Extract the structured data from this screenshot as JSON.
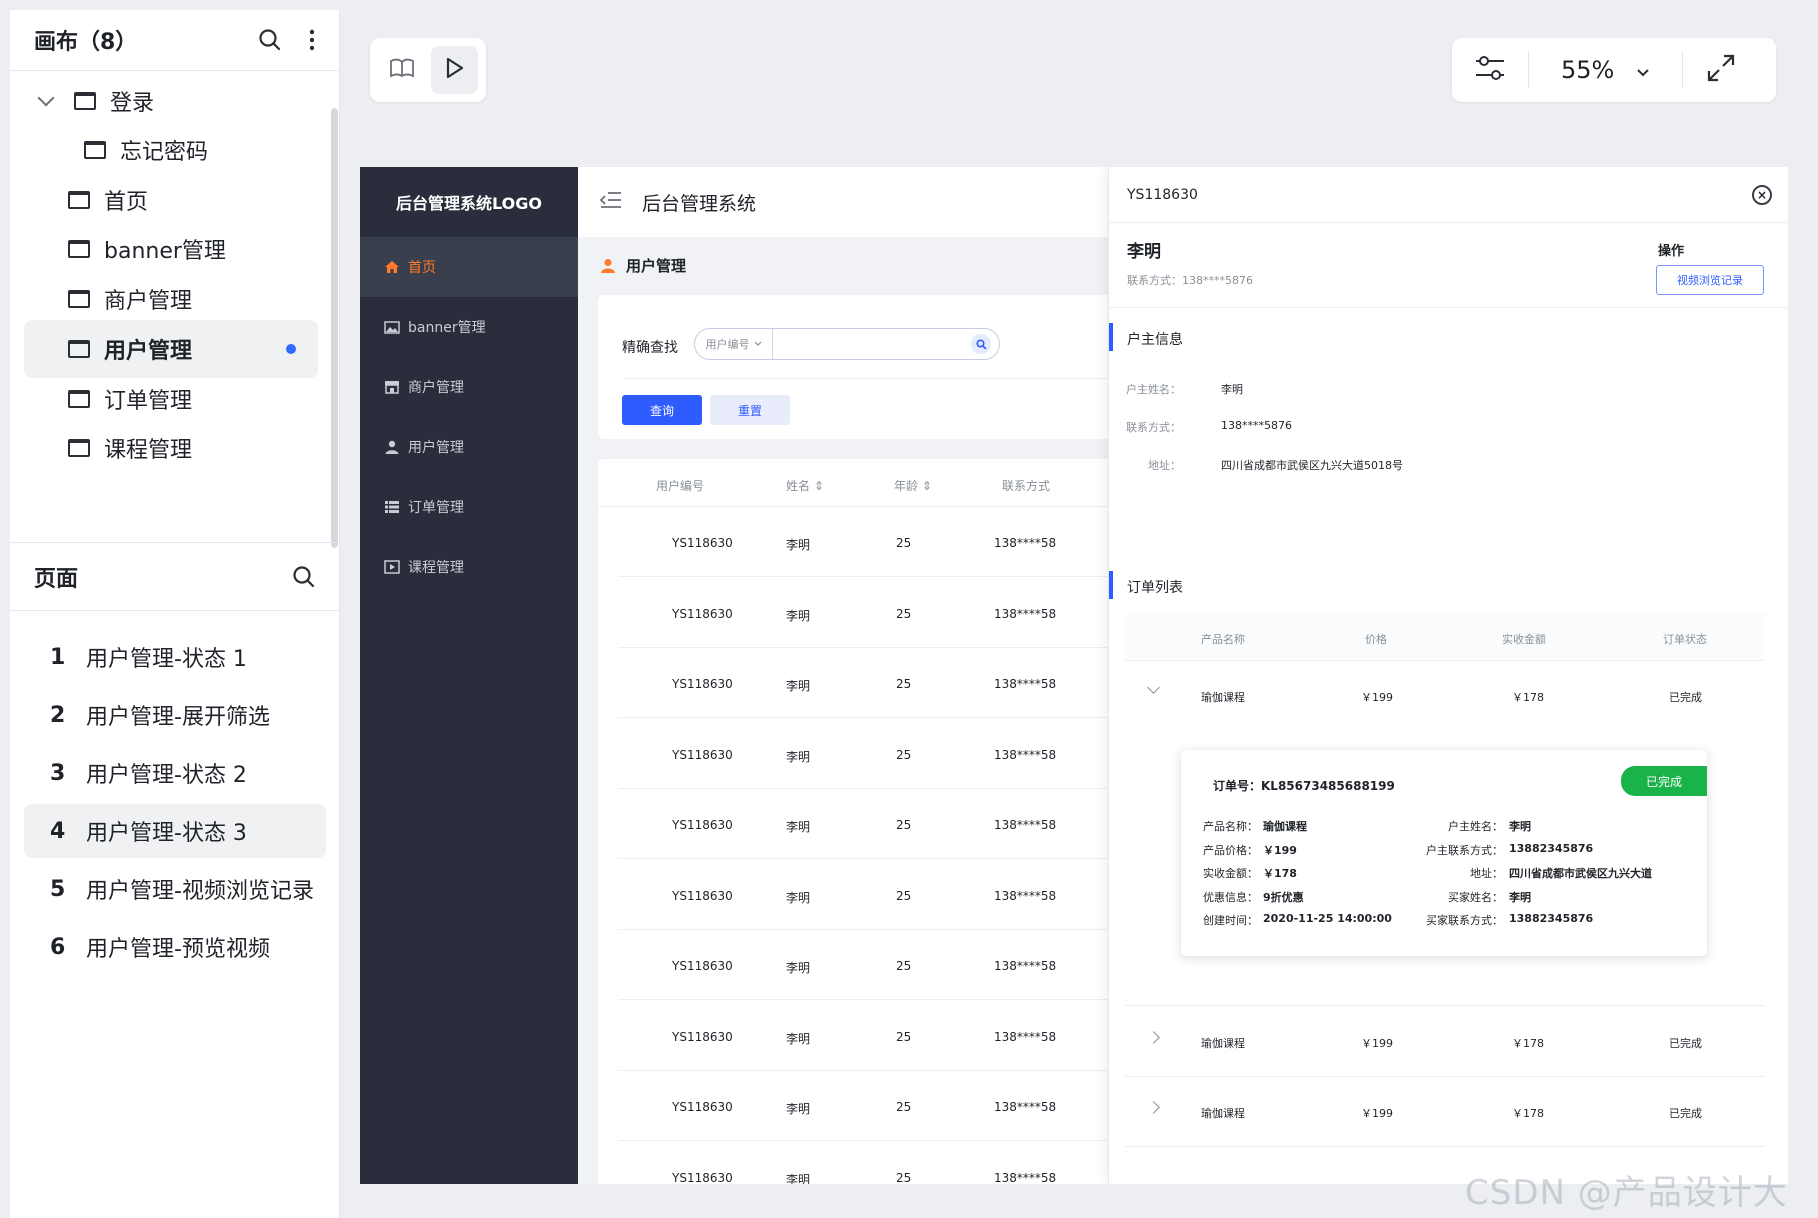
{
  "sidebar": {
    "canvas_title": "画布（8）",
    "tree": [
      {
        "label": "登录",
        "expanded": true
      },
      {
        "label": "忘记密码"
      },
      {
        "label": "首页"
      },
      {
        "label": "banner管理"
      },
      {
        "label": "商户管理"
      },
      {
        "label": "用户管理",
        "active": true
      },
      {
        "label": "订单管理"
      },
      {
        "label": "课程管理"
      }
    ],
    "pages_title": "页面",
    "pages": [
      {
        "num": "1",
        "label": "用户管理-状态 1"
      },
      {
        "num": "2",
        "label": "用户管理-展开筛选"
      },
      {
        "num": "3",
        "label": "用户管理-状态 2"
      },
      {
        "num": "4",
        "label": "用户管理-状态 3",
        "active": true
      },
      {
        "num": "5",
        "label": "用户管理-视频浏览记录"
      },
      {
        "num": "6",
        "label": "用户管理-预览视频"
      }
    ]
  },
  "toolbar": {
    "zoom": "55%"
  },
  "app": {
    "logo": "后台管理系统LOGO",
    "nav": [
      "首页",
      "banner管理",
      "商户管理",
      "用户管理",
      "订单管理",
      "课程管理"
    ],
    "header_title": "后台管理系统",
    "breadcrumb": "用户管理",
    "filter": {
      "label": "精确查找",
      "select_value": "用户编号",
      "query_btn": "查询",
      "reset_btn": "重置"
    },
    "table": {
      "headers": [
        "用户编号",
        "姓名",
        "年龄",
        "联系方式"
      ],
      "rows": [
        [
          "YS118630",
          "李明",
          "25",
          "138****58"
        ],
        [
          "YS118630",
          "李明",
          "25",
          "138****58"
        ],
        [
          "YS118630",
          "李明",
          "25",
          "138****58"
        ],
        [
          "YS118630",
          "李明",
          "25",
          "138****58"
        ],
        [
          "YS118630",
          "李明",
          "25",
          "138****58"
        ],
        [
          "YS118630",
          "李明",
          "25",
          "138****58"
        ],
        [
          "YS118630",
          "李明",
          "25",
          "138****58"
        ],
        [
          "YS118630",
          "李明",
          "25",
          "138****58"
        ],
        [
          "YS118630",
          "李明",
          "25",
          "138****58"
        ],
        [
          "YS118630",
          "李明",
          "25",
          "138****58"
        ]
      ]
    }
  },
  "drawer": {
    "id": "YS118630",
    "close": "×",
    "name": "李明",
    "contact": "联系方式：138****5876",
    "op_label": "操作",
    "video_btn": "视频浏览记录",
    "owner_section": "户主信息",
    "owner": [
      {
        "k": "户主姓名：",
        "v": "李明"
      },
      {
        "k": "联系方式：",
        "v": "138****5876"
      },
      {
        "k": "地址：",
        "v": "四川省成都市武侯区九兴大道5018号"
      }
    ],
    "orders_section": "订单列表",
    "order_headers": [
      "产品名称",
      "价格",
      "实收金额",
      "订单状态"
    ],
    "orders": [
      {
        "name": "瑜伽课程",
        "price": "￥199",
        "paid": "￥178",
        "status": "已完成"
      },
      {
        "name": "瑜伽课程",
        "price": "￥199",
        "paid": "￥178",
        "status": "已完成"
      },
      {
        "name": "瑜伽课程",
        "price": "￥199",
        "paid": "￥178",
        "status": "已完成"
      }
    ],
    "detail": {
      "title": "订单号：KL85673485688199",
      "badge": "已完成",
      "left": [
        {
          "k": "产品名称：",
          "v": "瑜伽课程"
        },
        {
          "k": "产品价格：",
          "v": "￥199"
        },
        {
          "k": "实收金额：",
          "v": "￥178"
        },
        {
          "k": "优惠信息：",
          "v": "9折优惠"
        },
        {
          "k": "创建时间：",
          "v": "2020-11-25 14:00:00"
        }
      ],
      "right": [
        {
          "k": "户主姓名：",
          "v": "李明"
        },
        {
          "k": "户主联系方式：",
          "v": "13882345876"
        },
        {
          "k": "地址：",
          "v": "四川省成都市武侯区九兴大道"
        },
        {
          "k": "买家姓名：",
          "v": "李明"
        },
        {
          "k": "买家联系方式：",
          "v": "13882345876"
        }
      ]
    }
  },
  "watermark": "CSDN @产品设计大观",
  "colors": {
    "accent": "#2f5cff",
    "nav_bg": "#2a2e3c",
    "nav_active": "#ff7a2a",
    "success": "#19b34a"
  }
}
